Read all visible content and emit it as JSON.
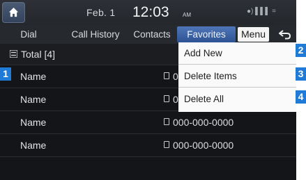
{
  "status_bar": {
    "home_icon": "home-icon",
    "date": "Feb.  1",
    "time": "12:03",
    "ampm": "AM",
    "status_icons": "●) ▌▌▌ ="
  },
  "tabs": {
    "dial": "Dial",
    "call_history": "Call History",
    "contacts": "Contacts",
    "favorites": "Favorites",
    "menu": "Menu",
    "back": "⮌"
  },
  "list": {
    "total_label": "Total [4]",
    "rows": [
      {
        "name": "Name",
        "number": "000-000-0000"
      },
      {
        "name": "Name",
        "number": "000-000-0000"
      },
      {
        "name": "Name",
        "number": "000-000-0000"
      },
      {
        "name": "Name",
        "number": "000-000-0000"
      }
    ]
  },
  "menu": {
    "items": [
      "Add New",
      "Delete Items",
      "Delete All"
    ]
  },
  "callouts": [
    "1",
    "2",
    "3",
    "4"
  ],
  "colors": {
    "accent": "#1f7bd6",
    "favorites_tab": "#3c63a6",
    "background": "#141518"
  }
}
